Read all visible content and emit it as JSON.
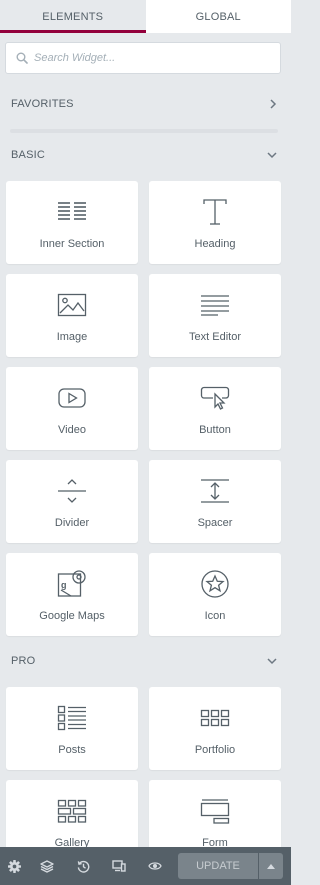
{
  "tabs": [
    {
      "label": "ELEMENTS",
      "active": true
    },
    {
      "label": "GLOBAL",
      "active": false
    }
  ],
  "search": {
    "placeholder": "Search Widget..."
  },
  "categories": {
    "favorites": {
      "title": "FAVORITES",
      "state": "collapsed"
    },
    "basic": {
      "title": "BASIC",
      "state": "expanded"
    },
    "pro": {
      "title": "PRO",
      "state": "expanded"
    }
  },
  "widgets": {
    "basic": [
      {
        "label": "Inner Section",
        "icon": "inner-section-icon"
      },
      {
        "label": "Heading",
        "icon": "heading-icon"
      },
      {
        "label": "Image",
        "icon": "image-icon"
      },
      {
        "label": "Text Editor",
        "icon": "text-editor-icon"
      },
      {
        "label": "Video",
        "icon": "video-icon"
      },
      {
        "label": "Button",
        "icon": "button-icon"
      },
      {
        "label": "Divider",
        "icon": "divider-icon"
      },
      {
        "label": "Spacer",
        "icon": "spacer-icon"
      },
      {
        "label": "Google Maps",
        "icon": "google-maps-icon"
      },
      {
        "label": "Icon",
        "icon": "star-icon"
      }
    ],
    "pro": [
      {
        "label": "Posts",
        "icon": "posts-icon"
      },
      {
        "label": "Portfolio",
        "icon": "portfolio-icon"
      },
      {
        "label": "Gallery",
        "icon": "gallery-icon"
      },
      {
        "label": "Form",
        "icon": "form-icon"
      }
    ]
  },
  "footer": {
    "icons": [
      "settings-icon",
      "navigator-icon",
      "history-icon",
      "responsive-icon",
      "preview-icon"
    ],
    "update_label": "UPDATE"
  },
  "colors": {
    "accent": "#93003c",
    "panel_bg": "#e6e9ec",
    "text": "#556068",
    "footer_bg": "#556068"
  }
}
